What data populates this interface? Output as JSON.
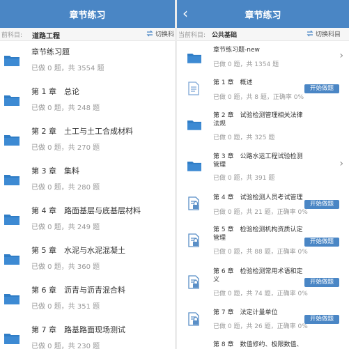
{
  "colors": {
    "header": "#4a86c5",
    "folder": "#2f7dc6",
    "doc": "#5a8fc7"
  },
  "left": {
    "title": "章节练习",
    "subject_label": "前科目:",
    "subject_value": "道路工程",
    "switch_label": "切换科",
    "items": [
      {
        "title": "章节练习题",
        "stats": "已做 0 题，共 3554 题"
      },
      {
        "title": "第 1 章　总论",
        "stats": "已做 0 题，共 248 题"
      },
      {
        "title": "第 2 章　土工与土工合成材料",
        "stats": "已做 0 题，共 270 题"
      },
      {
        "title": "第 3 章　集料",
        "stats": "已做 0 题，共 280 题"
      },
      {
        "title": "第 4 章　路面基层与底基层材料",
        "stats": "已做 0 题，共 249 题"
      },
      {
        "title": "第 5 章　水泥与水泥混凝土",
        "stats": "已做 0 题，共 360 题"
      },
      {
        "title": "第 6 章　沥青与沥青混合料",
        "stats": "已做 0 题，共 351 题"
      },
      {
        "title": "第 7 章　路基路面现场测试",
        "stats": "已做 0 题，共 230 题"
      }
    ]
  },
  "right": {
    "title": "章节练习",
    "back_icon": "chevron-left-icon",
    "subject_label": "当前科目:",
    "subject_value": "公共基础",
    "switch_label": "切换科目",
    "start_label": "开始做题",
    "items": [
      {
        "title": "章节练习题-new",
        "stats": "已做 0 题，共 1354 题"
      },
      {
        "title": "第 1 章　概述",
        "stats": "已做 0 题，共 8 题，正确率 0%"
      },
      {
        "title": "第 2 章　试验检测管理相关法律法规",
        "stats": "已做 0 题，共 325 题"
      },
      {
        "title": "第 3 章　公路水运工程试验检测管理",
        "stats": "已做 0 题，共 391 题"
      },
      {
        "title": "第 4 章　试验检测人员考试管理",
        "stats": "已做 0 题，共 21 题，正确率 0%"
      },
      {
        "title": "第 5 章　检验检测机构资质认定管理",
        "stats": "已做 0 题，共 88 题，正确率 0%"
      },
      {
        "title": "第 6 章　检验检测常用术语和定义",
        "stats": "已做 0 题，共 74 题，正确率 0%"
      },
      {
        "title": "第 7 章　法定计量单位",
        "stats": "已做 0 题，共 26 题，正确率 0%"
      },
      {
        "title": "第 8 章　数值修约、极限数值、",
        "stats": ""
      }
    ]
  }
}
